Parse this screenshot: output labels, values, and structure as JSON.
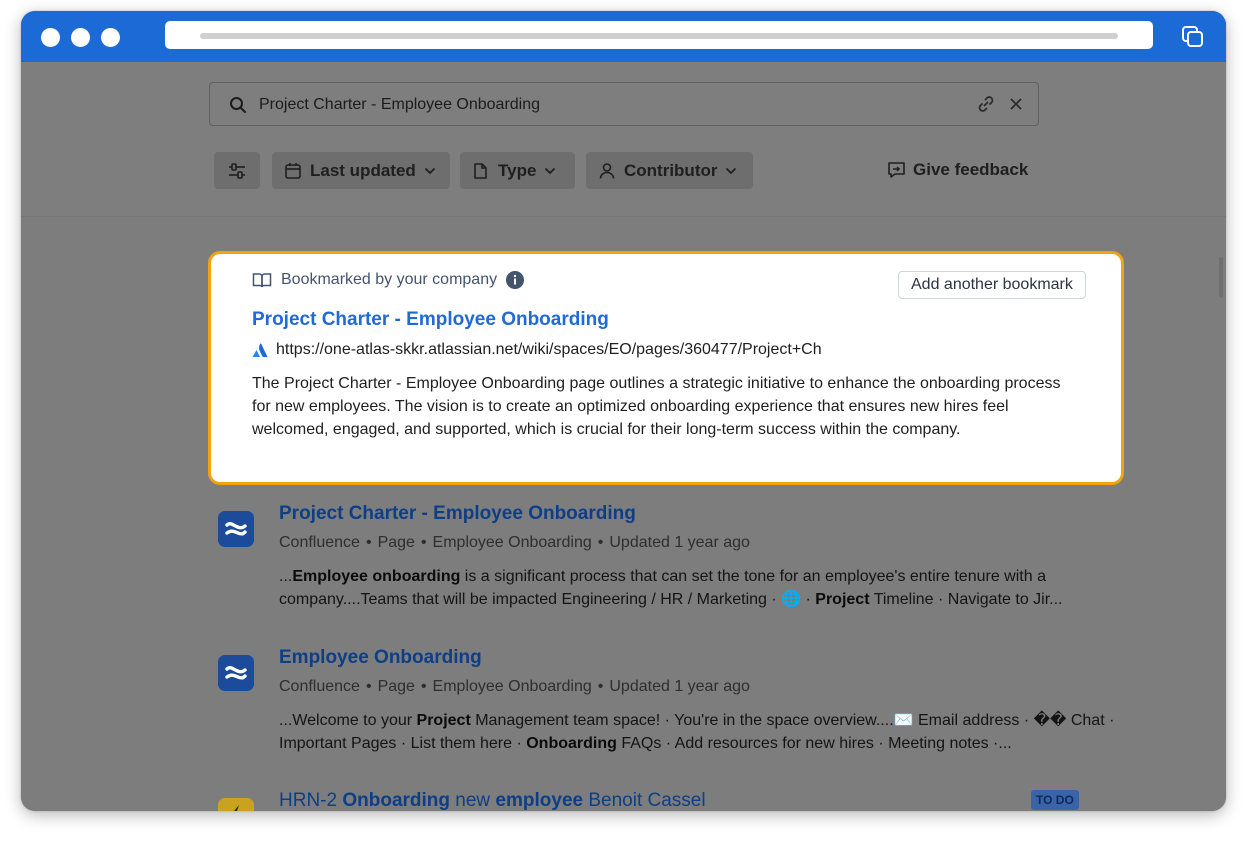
{
  "search": {
    "query": "Project Charter - Employee Onboarding"
  },
  "filters": {
    "last_updated": "Last updated",
    "type": "Type",
    "contributor": "Contributor",
    "feedback": "Give feedback"
  },
  "bookmark": {
    "header": "Bookmarked by your company",
    "add_button": "Add another bookmark",
    "title": "Project Charter - Employee Onboarding",
    "url": "https://one-atlas-skkr.atlassian.net/wiki/spaces/EO/pages/360477/Project+Ch",
    "description": "The Project Charter - Employee Onboarding page outlines a strategic initiative to enhance the onboarding process for new employees. The vision is to create an optimized onboarding experience that ensures new hires feel welcomed, engaged, and supported, which is crucial for their long-term success within the company."
  },
  "results": [
    {
      "title": "Project Charter - Employee Onboarding",
      "meta": [
        "Confluence",
        "Page",
        "Employee Onboarding",
        "Updated 1 year ago"
      ],
      "snippet": [
        {
          "t": "...",
          "b": false
        },
        {
          "t": "Employee onboarding",
          "b": true
        },
        {
          "t": " is a significant process that can set the tone for an employee's entire tenure with a company....Teams that will be impacted Engineering / HR / Marketing · ",
          "b": false
        },
        {
          "t": "🌐",
          "b": false
        },
        {
          "t": " · ",
          "b": false
        },
        {
          "t": "Project",
          "b": true
        },
        {
          "t": " Timeline · Navigate to Jir...",
          "b": false
        }
      ]
    },
    {
      "title": "Employee Onboarding",
      "meta": [
        "Confluence",
        "Page",
        "Employee Onboarding",
        "Updated 1 year ago"
      ],
      "snippet": [
        {
          "t": "...Welcome to your ",
          "b": false
        },
        {
          "t": "Project",
          "b": true
        },
        {
          "t": " Management team space! · You're in the space overview....✉️ Email address · �� Chat · Important Pages · List them here · ",
          "b": false
        },
        {
          "t": "Onboarding",
          "b": true
        },
        {
          "t": " FAQs · Add resources for new hires · Meeting notes ·...",
          "b": false
        }
      ]
    },
    {
      "title_parts": [
        {
          "t": "HRN-2 ",
          "b": false
        },
        {
          "t": "Onboarding",
          "b": true
        },
        {
          "t": " new ",
          "b": false
        },
        {
          "t": "employee",
          "b": true
        },
        {
          "t": " Benoit Cassel",
          "b": false
        }
      ],
      "status": "TO DO"
    }
  ]
}
